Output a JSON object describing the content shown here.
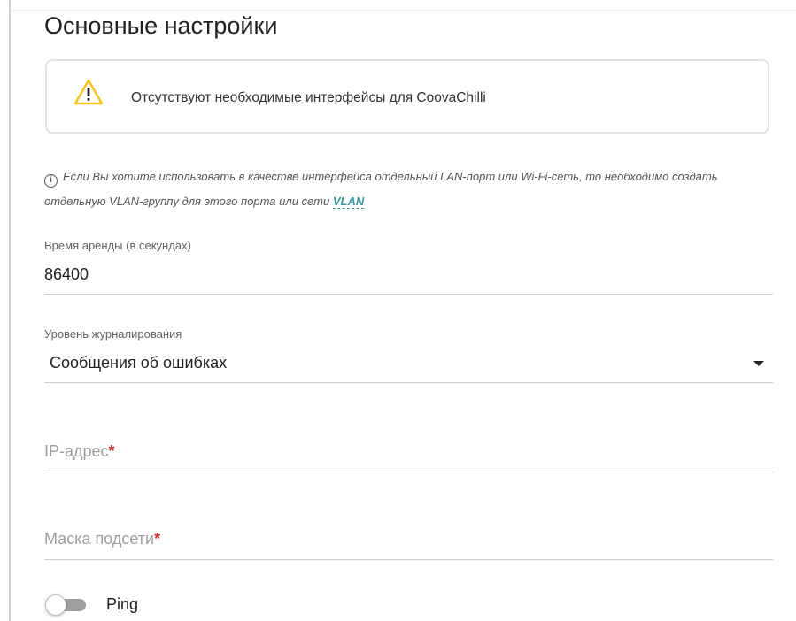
{
  "section": {
    "title": "Основные настройки"
  },
  "alert": {
    "icon": "warning-icon",
    "text": "Отсутствуют необходимые интерфейсы для CoovaChilli",
    "icon_color": "#f5c518"
  },
  "info": {
    "icon": "info-icon",
    "text": "Если Вы хотите использовать в качестве интерфейса отдельный LAN-порт или Wi-Fi-сеть, то необходимо создать отдельную VLAN-группу для этого порта или сети",
    "link_text": "VLAN"
  },
  "lease_time": {
    "label": "Время аренды (в секундах)",
    "value": "86400"
  },
  "log_level": {
    "label": "Уровень журналирования",
    "selected": "Сообщения об ошибках"
  },
  "ip_address": {
    "placeholder": "IP-адрес",
    "required_mark": "*"
  },
  "subnet_mask": {
    "placeholder": "Маска подсети",
    "required_mark": "*"
  },
  "ping": {
    "label": "Ping",
    "enabled": false
  },
  "colors": {
    "link": "#3a9aa3",
    "required": "#d32f2f"
  }
}
